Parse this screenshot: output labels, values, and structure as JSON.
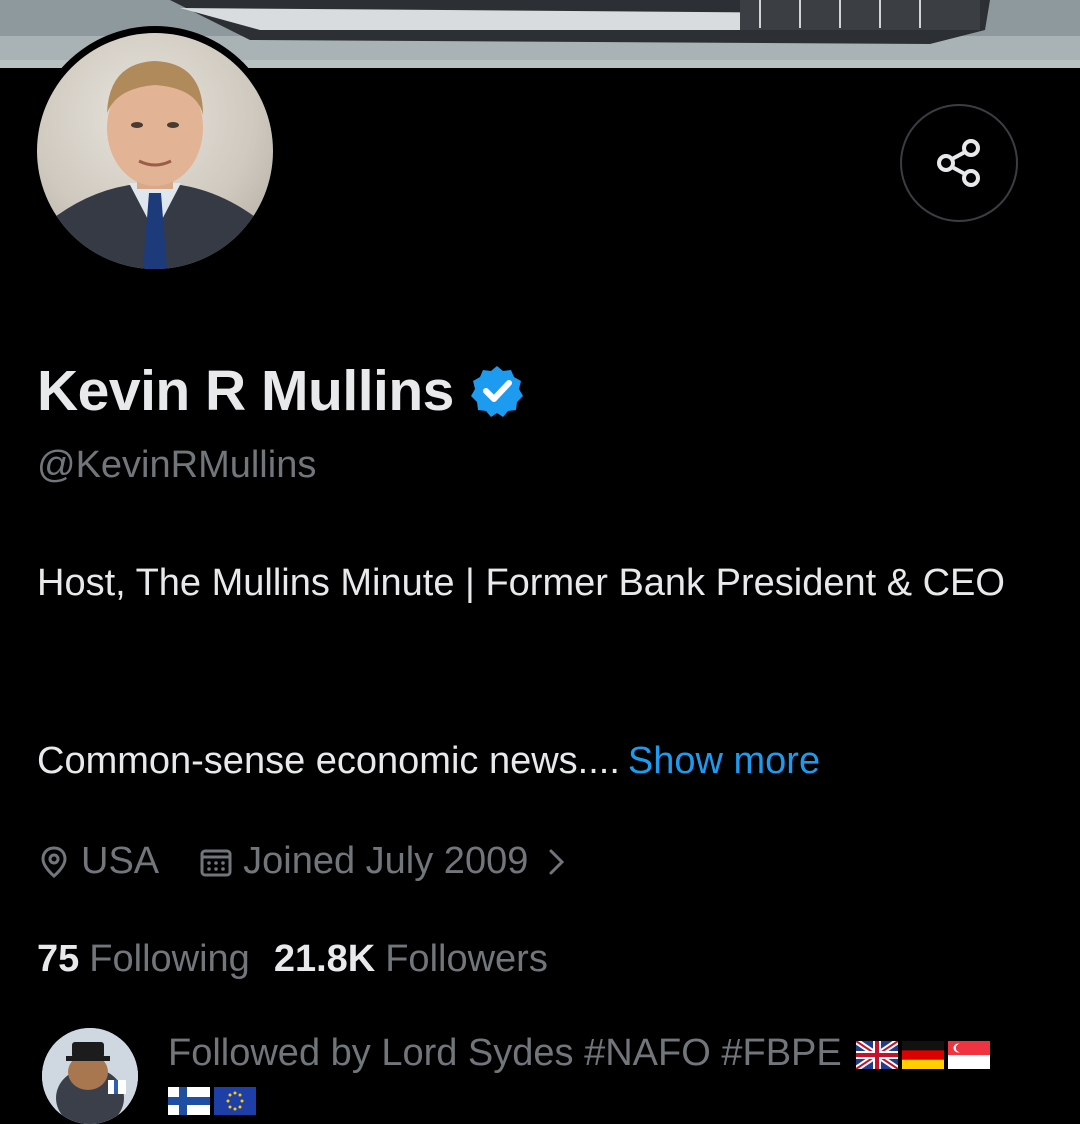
{
  "profile": {
    "name": "Kevin R Mullins",
    "handle": "@KevinRMullins",
    "bio_line1": "Host, The Mullins Minute | Former Bank President & CEO",
    "bio_line2": "Common-sense economic news....",
    "show_more": "Show more",
    "location": "USA",
    "joined": "Joined July 2009"
  },
  "stats": {
    "following_count": "75",
    "following_label": "Following",
    "followers_count": "21.8K",
    "followers_label": "Followers"
  },
  "followed_by": {
    "text": "Followed by Lord Sydes #NAFO #FBPE",
    "flags": [
      "uk-flag",
      "germany-flag",
      "singapore-flag",
      "finland-flag",
      "eu-flag"
    ]
  },
  "colors": {
    "background": "#000000",
    "primary_text": "#e7e9ea",
    "secondary_text": "#71767b",
    "link": "#1d9bf0",
    "verified": "#1d9bf0"
  },
  "icons": [
    "share-icon",
    "verified-badge-icon",
    "location-icon",
    "calendar-icon",
    "chevron-right-icon"
  ]
}
